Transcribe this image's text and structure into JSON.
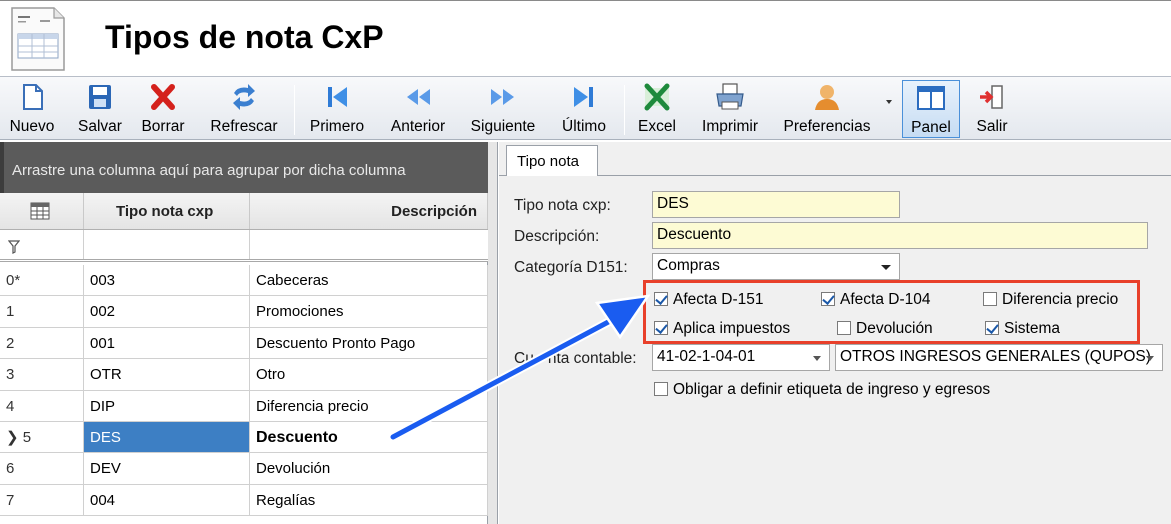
{
  "window": {
    "title": "Tipos de nota CxP"
  },
  "toolbar": {
    "buttons": [
      {
        "label": "Nuevo",
        "icon": "new-document-icon"
      },
      {
        "label": "Salvar",
        "icon": "save-disk-icon"
      },
      {
        "label": "Borrar",
        "icon": "delete-x-icon"
      },
      {
        "label": "Refrescar",
        "icon": "refresh-arrows-icon"
      },
      {
        "label": "Primero",
        "icon": "first-record-icon"
      },
      {
        "label": "Anterior",
        "icon": "previous-record-icon"
      },
      {
        "label": "Siguiente",
        "icon": "next-record-icon"
      },
      {
        "label": "Último",
        "icon": "last-record-icon"
      },
      {
        "label": "Excel",
        "icon": "excel-icon"
      },
      {
        "label": "Imprimir",
        "icon": "printer-icon"
      },
      {
        "label": "Preferencias",
        "icon": "user-preferences-icon"
      },
      {
        "label": "Panel",
        "icon": "panel-icon"
      },
      {
        "label": "Salir",
        "icon": "exit-door-icon"
      }
    ]
  },
  "grid": {
    "group_hint": "Arrastre una columna aquí para agrupar por dicha columna",
    "columns": [
      "Tipo nota cxp",
      "Descripción"
    ],
    "rows": [
      {
        "index": "0*",
        "code": "003",
        "desc": "Cabeceras"
      },
      {
        "index": "1",
        "code": "002",
        "desc": "Promociones"
      },
      {
        "index": "2",
        "code": "001",
        "desc": "Descuento Pronto Pago"
      },
      {
        "index": "3",
        "code": "OTR",
        "desc": "Otro"
      },
      {
        "index": "4",
        "code": "DIP",
        "desc": "Diferencia precio"
      },
      {
        "index": "5",
        "code": "DES",
        "desc": "Descuento"
      },
      {
        "index": "6",
        "code": "DEV",
        "desc": "Devolución"
      },
      {
        "index": "7",
        "code": "004",
        "desc": "Regalías"
      }
    ],
    "selected_row": 5
  },
  "detail": {
    "tab": "Tipo nota",
    "labels": {
      "tipo_nota": "Tipo nota cxp:",
      "descripcion": "Descripción:",
      "categoria": "Categoría D151:",
      "cuenta_pre": "Cu",
      "cuenta_post": "nta contable:"
    },
    "values": {
      "tipo_nota": "DES",
      "descripcion": "Descuento",
      "categoria": "Compras",
      "cuenta_codigo": "41-02-1-04-01",
      "cuenta_nombre": "OTROS INGRESOS GENERALES (QUPOS)"
    },
    "checks": {
      "afecta_d151": {
        "label": "Afecta D-151",
        "checked": true
      },
      "afecta_d104": {
        "label": "Afecta D-104",
        "checked": true
      },
      "diferencia_precio": {
        "label": "Diferencia precio",
        "checked": false
      },
      "aplica_impuestos": {
        "label": "Aplica impuestos",
        "checked": true
      },
      "devolucion": {
        "label": "Devolución",
        "checked": false
      },
      "sistema": {
        "label": "Sistema",
        "checked": true
      },
      "obligar_etiqueta": {
        "label": "Obligar a definir etiqueta de ingreso y egresos",
        "checked": false
      }
    }
  },
  "colors": {
    "highlight": "#e8402a",
    "annotation_arrow": "#1a5cf0",
    "selection": "#3d7fc4",
    "input_bg": "#fdfbd4"
  }
}
